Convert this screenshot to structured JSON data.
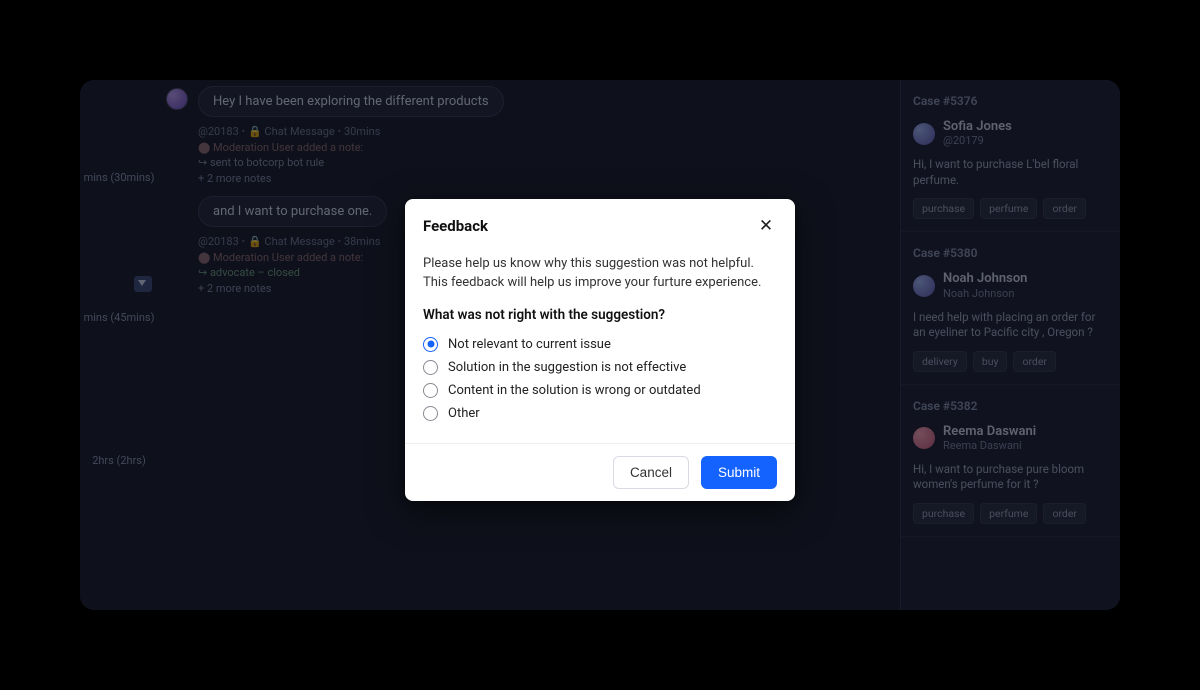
{
  "left": {
    "timeline": {
      "t1": "mins (30mins)",
      "t2": "mins (45mins)",
      "t3": "2hrs (2hrs)"
    },
    "msg1": {
      "text": "Hey I have been exploring the different products",
      "meta_id": "@20183",
      "meta_type": "Chat Message",
      "meta_time": "30mins",
      "note_line": "⬤ Moderation User added a note:",
      "wnote": "↪ sent to botcorp bot rule",
      "more": "+ 2 more notes"
    },
    "msg2": {
      "text": "and I want to purchase one.",
      "meta_id": "@20183",
      "meta_type": "Chat Message",
      "meta_time": "38mins",
      "note_line": "⬤ Moderation User added a note:",
      "wnote": "↪ advocate – closed",
      "more": "+ 2 more notes"
    }
  },
  "right": {
    "cases": [
      {
        "id": "Case #5376",
        "name": "Sofia Jones",
        "sub": "@20179",
        "text": "Hi, I want to purchase L'bel floral perfume.",
        "tags": [
          "purchase",
          "perfume",
          "order"
        ],
        "avatar_class": ""
      },
      {
        "id": "Case #5380",
        "name": "Noah Johnson",
        "sub": "Noah Johnson",
        "text": "I need help with placing an order for an eyeliner to Pacific city , Oregon ?",
        "tags": [
          "delivery",
          "buy",
          "order"
        ],
        "avatar_class": ""
      },
      {
        "id": "Case #5382",
        "name": "Reema Daswani",
        "sub": "Reema Daswani",
        "text": "Hi, I want to purchase pure bloom women's perfume for it ?",
        "tags": [
          "purchase",
          "perfume",
          "order"
        ],
        "avatar_class": "pink"
      }
    ]
  },
  "modal": {
    "title": "Feedback",
    "desc": "Please help us know why this suggestion was not helpful. This feedback will help us improve your furture experience.",
    "question": "What was not right with the suggestion?",
    "options": [
      "Not relevant to current issue",
      "Solution in the suggestion is not effective",
      "Content in the solution is wrong or outdated",
      "Other"
    ],
    "selected_index": 0,
    "cancel": "Cancel",
    "submit": "Submit"
  }
}
